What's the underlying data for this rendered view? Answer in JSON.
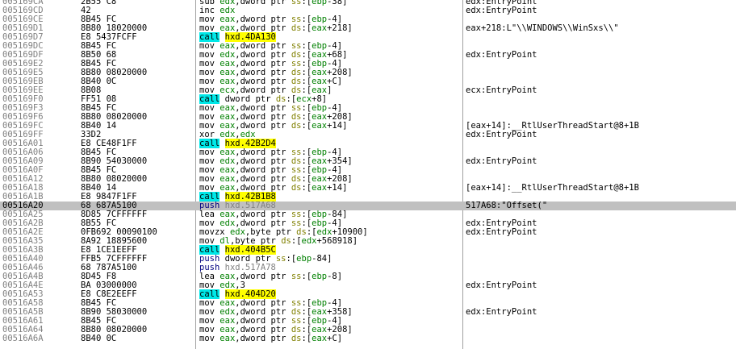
{
  "window": {
    "title": ""
  },
  "colors": {
    "call_highlight": "#00e8e8",
    "symbol_highlight": "#ffff00",
    "selected_row": "#c0c0c0",
    "register": "#008000",
    "segment": "#808000",
    "address": "#808080"
  },
  "rows": [
    {
      "addr": "005169CA",
      "bytes": "2B55 C8",
      "instr": "sub edx,dword ptr ss:[ebp-38]",
      "comment": "edx:EntryPoint"
    },
    {
      "addr": "005169CD",
      "bytes": "42",
      "instr": "inc edx",
      "comment": "edx:EntryPoint"
    },
    {
      "addr": "005169CE",
      "bytes": "8B45 FC",
      "instr": "mov eax,dword ptr ss:[ebp-4]",
      "comment": ""
    },
    {
      "addr": "005169D1",
      "bytes": "8B80 18020000",
      "instr": "mov eax,dword ptr ds:[eax+218]",
      "comment": "eax+218:L\"\\\\WINDOWS\\\\WinSxs\\\\\""
    },
    {
      "addr": "005169D7",
      "bytes": "E8 5437FCFF",
      "instr": "call hxd.4DA130",
      "comment": "",
      "call": true
    },
    {
      "addr": "005169DC",
      "bytes": "8B45 FC",
      "instr": "mov eax,dword ptr ss:[ebp-4]",
      "comment": ""
    },
    {
      "addr": "005169DF",
      "bytes": "8B50 68",
      "instr": "mov edx,dword ptr ds:[eax+68]",
      "comment": "edx:EntryPoint"
    },
    {
      "addr": "005169E2",
      "bytes": "8B45 FC",
      "instr": "mov eax,dword ptr ss:[ebp-4]",
      "comment": ""
    },
    {
      "addr": "005169E5",
      "bytes": "8B80 08020000",
      "instr": "mov eax,dword ptr ds:[eax+208]",
      "comment": ""
    },
    {
      "addr": "005169EB",
      "bytes": "8B40 0C",
      "instr": "mov eax,dword ptr ds:[eax+C]",
      "comment": ""
    },
    {
      "addr": "005169EE",
      "bytes": "8B08",
      "instr": "mov ecx,dword ptr ds:[eax]",
      "comment": "ecx:EntryPoint"
    },
    {
      "addr": "005169F0",
      "bytes": "FF51 08",
      "instr": "call dword ptr ds:[ecx+8]",
      "comment": "",
      "call": true
    },
    {
      "addr": "005169F3",
      "bytes": "8B45 FC",
      "instr": "mov eax,dword ptr ss:[ebp-4]",
      "comment": ""
    },
    {
      "addr": "005169F6",
      "bytes": "8B80 08020000",
      "instr": "mov eax,dword ptr ds:[eax+208]",
      "comment": ""
    },
    {
      "addr": "005169FC",
      "bytes": "8B40 14",
      "instr": "mov eax,dword ptr ds:[eax+14]",
      "comment": "[eax+14]:__RtlUserThreadStart@8+1B"
    },
    {
      "addr": "005169FF",
      "bytes": "33D2",
      "instr": "xor edx,edx",
      "comment": "edx:EntryPoint"
    },
    {
      "addr": "00516A01",
      "bytes": "E8 CE48F1FF",
      "instr": "call hxd.42B2D4",
      "comment": "",
      "call": true
    },
    {
      "addr": "00516A06",
      "bytes": "8B45 FC",
      "instr": "mov eax,dword ptr ss:[ebp-4]",
      "comment": ""
    },
    {
      "addr": "00516A09",
      "bytes": "8B90 54030000",
      "instr": "mov edx,dword ptr ds:[eax+354]",
      "comment": "edx:EntryPoint"
    },
    {
      "addr": "00516A0F",
      "bytes": "8B45 FC",
      "instr": "mov eax,dword ptr ss:[ebp-4]",
      "comment": ""
    },
    {
      "addr": "00516A12",
      "bytes": "8B80 08020000",
      "instr": "mov eax,dword ptr ds:[eax+208]",
      "comment": ""
    },
    {
      "addr": "00516A18",
      "bytes": "8B40 14",
      "instr": "mov eax,dword ptr ds:[eax+14]",
      "comment": "[eax+14]:__RtlUserThreadStart@8+1B"
    },
    {
      "addr": "00516A1B",
      "bytes": "E8 9847F1FF",
      "instr": "call hxd.42B1B8",
      "comment": "",
      "call": true
    },
    {
      "addr": "00516A20",
      "bytes": "68 687A5100",
      "instr": "push hxd.517A68",
      "comment": "517A68:\"Offset(\"",
      "selected": true
    },
    {
      "addr": "00516A25",
      "bytes": "8D85 7CFFFFFF",
      "instr": "lea eax,dword ptr ss:[ebp-84]",
      "comment": ""
    },
    {
      "addr": "00516A2B",
      "bytes": "8B55 FC",
      "instr": "mov edx,dword ptr ss:[ebp-4]",
      "comment": "edx:EntryPoint"
    },
    {
      "addr": "00516A2E",
      "bytes": "0FB692 00090100",
      "instr": "movzx edx,byte ptr ds:[edx+10900]",
      "comment": "edx:EntryPoint"
    },
    {
      "addr": "00516A35",
      "bytes": "8A92 18895600",
      "instr": "mov dl,byte ptr ds:[edx+568918]",
      "comment": ""
    },
    {
      "addr": "00516A3B",
      "bytes": "E8 1CE1EEFF",
      "instr": "call hxd.404B5C",
      "comment": "",
      "call": true
    },
    {
      "addr": "00516A40",
      "bytes": "FFB5 7CFFFFFF",
      "instr": "push dword ptr ss:[ebp-84]",
      "comment": ""
    },
    {
      "addr": "00516A46",
      "bytes": "68 787A5100",
      "instr": "push hxd.517A78",
      "comment": ""
    },
    {
      "addr": "00516A4B",
      "bytes": "8D45 F8",
      "instr": "lea eax,dword ptr ss:[ebp-8]",
      "comment": ""
    },
    {
      "addr": "00516A4E",
      "bytes": "BA 03000000",
      "instr": "mov edx,3",
      "comment": "edx:EntryPoint"
    },
    {
      "addr": "00516A53",
      "bytes": "E8 C8E2EEFF",
      "instr": "call hxd.404D20",
      "comment": "",
      "call": true
    },
    {
      "addr": "00516A58",
      "bytes": "8B45 FC",
      "instr": "mov eax,dword ptr ss:[ebp-4]",
      "comment": ""
    },
    {
      "addr": "00516A5B",
      "bytes": "8B90 58030000",
      "instr": "mov edx,dword ptr ds:[eax+358]",
      "comment": "edx:EntryPoint"
    },
    {
      "addr": "00516A61",
      "bytes": "8B45 FC",
      "instr": "mov eax,dword ptr ss:[ebp-4]",
      "comment": ""
    },
    {
      "addr": "00516A64",
      "bytes": "8B80 08020000",
      "instr": "mov eax,dword ptr ds:[eax+208]",
      "comment": ""
    },
    {
      "addr": "00516A6A",
      "bytes": "8B40 0C",
      "instr": "mov eax,dword ptr ds:[eax+C]",
      "comment": ""
    }
  ]
}
